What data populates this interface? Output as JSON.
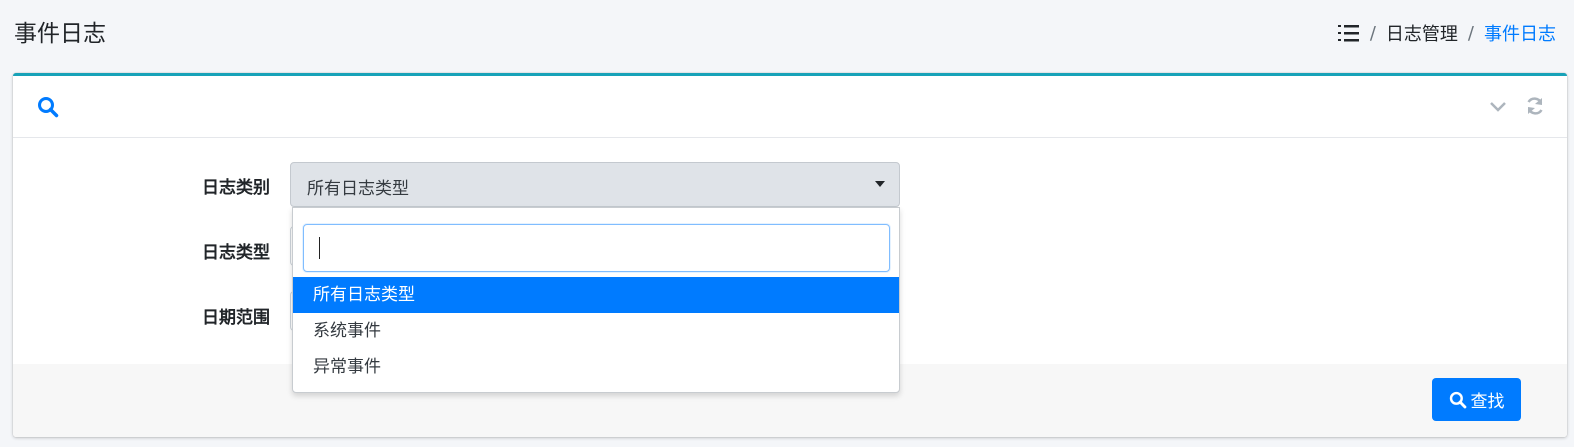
{
  "page": {
    "title": "事件日志"
  },
  "breadcrumb": {
    "items": [
      "日志管理",
      "事件日志"
    ],
    "separator": "/"
  },
  "colors": {
    "accent": "#007bff",
    "card_border": "#17a2b8"
  },
  "filters": {
    "log_category": {
      "label": "日志类别",
      "selected": "所有日志类型"
    },
    "log_type": {
      "label": "日志类型"
    },
    "date_range": {
      "label": "日期范围"
    }
  },
  "dropdown": {
    "search_value": "",
    "options": [
      "所有日志类型",
      "系统事件",
      "异常事件"
    ],
    "selected_index": 0
  },
  "actions": {
    "search_label": "查找"
  },
  "icons": {
    "breadcrumb": "list-icon",
    "card_header": "search-icon",
    "tools": [
      "chevron-down-icon",
      "refresh-icon"
    ],
    "search_button": "search-icon"
  }
}
